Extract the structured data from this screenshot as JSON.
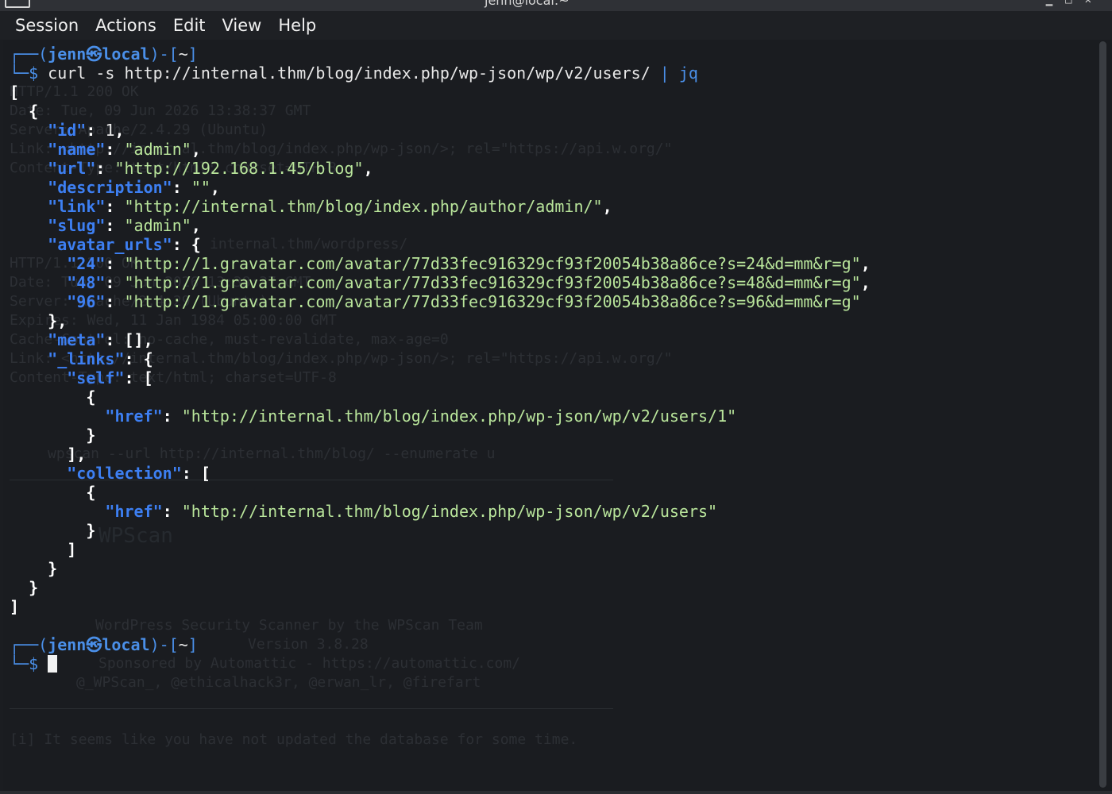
{
  "window": {
    "title": "jenn@local:~"
  },
  "menu": {
    "items": [
      "Session",
      "Actions",
      "Edit",
      "View",
      "Help"
    ]
  },
  "prompt": {
    "user": "jenn",
    "host": "local",
    "cwd": "~"
  },
  "command": {
    "text": "curl -s http://internal.thm/blog/index.php/wp-json/wp/v2/users/ ",
    "pipe": "|",
    "filter": "jq"
  },
  "user_record": {
    "id": "1",
    "name": "\"admin\"",
    "url": "\"http://192.168.1.45/blog\"",
    "description": "\"\"",
    "link": "\"http://internal.thm/blog/index.php/author/admin/\"",
    "slug": "\"admin\"",
    "avatar_24": "\"http://1.gravatar.com/avatar/77d33fec916329cf93f20054b38a86ce?s=24&d=mm&r=g\"",
    "avatar_48": "\"http://1.gravatar.com/avatar/77d33fec916329cf93f20054b38a86ce?s=48&d=mm&r=g\"",
    "avatar_96": "\"http://1.gravatar.com/avatar/77d33fec916329cf93f20054b38a86ce?s=96&d=mm&r=g\"",
    "self_href": "\"http://internal.thm/blog/index.php/wp-json/wp/v2/users/1\"",
    "collection_href": "\"http://internal.thm/blog/index.php/wp-json/wp/v2/users\""
  },
  "keys": {
    "id": "\"id\"",
    "name": "\"name\"",
    "url": "\"url\"",
    "description": "\"description\"",
    "link": "\"link\"",
    "slug": "\"slug\"",
    "avatar_urls": "\"avatar_urls\"",
    "s24": "\"24\"",
    "s48": "\"48\"",
    "s96": "\"96\"",
    "meta": "\"meta\"",
    "links": "\"_links\"",
    "self": "\"self\"",
    "href": "\"href\"",
    "collection": "\"collection\""
  },
  "ghost_text": {
    "l1": "HTTP/1.1 200 OK",
    "l2": "Date: Tue, 09 Jun 2026 13:38:37 GMT",
    "l3": "Server: Apache/2.4.29 (Ubuntu)",
    "l4": "Link: <http://internal.thm/blog/index.php/wp-json/>; rel=\"https://api.w.org/\"",
    "l5": "Content-Type: text/html; charset=UTF-8",
    "l6": "internal.thm/wordpress/",
    "l7": "HTTP/1.1 200 OK",
    "l8": "Date: Tue, 09 Jun 2026 13:38:37 GMT",
    "l9": "Server: Apache/2.4.29 (Ubuntu)",
    "l10": "Expires: Wed, 11 Jan 1984 05:00:00 GMT",
    "l11": "Cache-Control: no-cache, must-revalidate, max-age=0",
    "l12": "Link: <http://internal.thm/blog/index.php/wp-json/>; rel=\"https://api.w.org/\"",
    "l13": "Content-Type: text/html; charset=UTF-8",
    "l14": "wpscan --url http://internal.thm/blog/ --enumerate u",
    "l15": "WordPress Security Scanner by the WPScan Team",
    "l16": "Version 3.8.28",
    "l17": "Sponsored by Automattic - https://automattic.com/",
    "l18": "@_WPScan_, @ethicalhack3r, @erwan_lr, @firefart",
    "l19": "[i] It seems like you have not updated the database for some time.",
    "art": "WPScan"
  }
}
